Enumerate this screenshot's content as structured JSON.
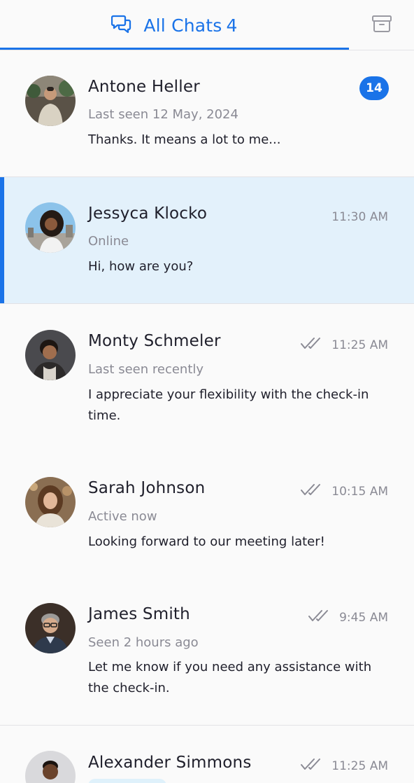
{
  "tabs": {
    "all_label": "All Chats",
    "all_count": "4",
    "archive_icon": "archive-icon"
  },
  "colors": {
    "accent": "#1a73e8",
    "selected_bg": "#e3f1fb",
    "muted": "#8a8a94"
  },
  "chats": [
    {
      "name": "Antone Heller",
      "status": "Last seen 12 May, 2024",
      "message": "Thanks. It means a lot to me...",
      "unread": "14"
    },
    {
      "name": "Jessyca Klocko",
      "status": "Online",
      "message": "Hi, how are you?",
      "time": "11:30 AM"
    },
    {
      "name": "Monty Schmeler",
      "status": "Last seen recently",
      "message": "I appreciate your flexibility with the check-in time.",
      "time": "11:25 AM"
    },
    {
      "name": "Sarah Johnson",
      "status": "Active now",
      "message": "Looking forward to our meeting later!",
      "time": "10:15 AM"
    },
    {
      "name": "James Smith",
      "status": "Seen 2 hours ago",
      "message": "Let me know if you need any assistance with the check-in.",
      "time": "9:45 AM"
    },
    {
      "name": "Alexander Simmons",
      "time": "11:25 AM"
    }
  ]
}
